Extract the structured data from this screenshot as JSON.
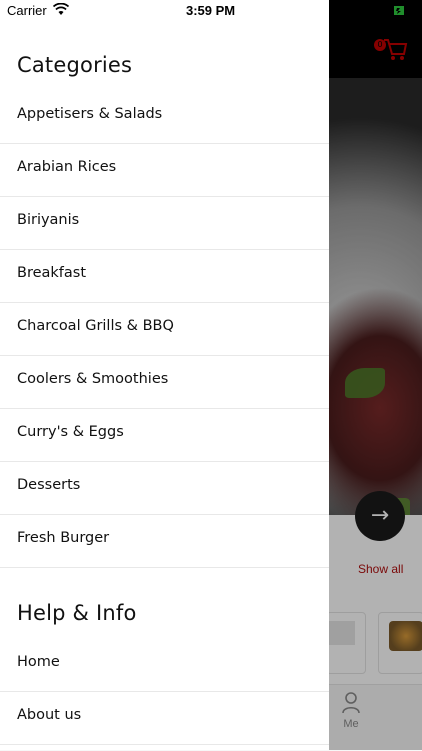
{
  "status_bar": {
    "carrier": "Carrier",
    "time": "3:59 PM"
  },
  "background": {
    "cart_count": "0",
    "show_all": "Show all",
    "nav_me": "Me"
  },
  "drawer": {
    "categories_title": "Categories",
    "categories": [
      "Appetisers & Salads",
      "Arabian Rices",
      "Biriyanis",
      "Breakfast",
      "Charcoal Grills & BBQ",
      "Coolers & Smoothies",
      "Curry's & Eggs",
      "Desserts",
      "Fresh Burger"
    ],
    "help_title": "Help & Info",
    "help_items": [
      "Home",
      "About us"
    ]
  },
  "colors": {
    "accent": "#b00f0f",
    "topbar": "#000000",
    "drawer_bg": "#ffffff",
    "divider": "#e8e8e8"
  },
  "icons": {
    "wifi": "wifi-icon",
    "battery": "battery-icon",
    "cart": "cart-icon",
    "arrow": "arrow-right-icon",
    "me": "person-icon"
  }
}
